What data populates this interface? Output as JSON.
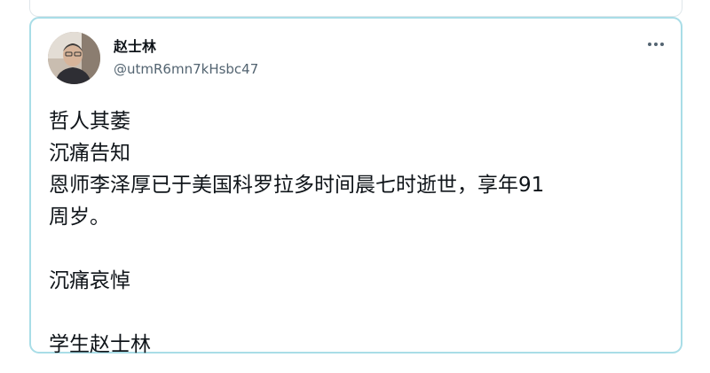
{
  "tweet": {
    "author_name": "赵士林",
    "author_handle": "@utmR6mn7kHsbc47",
    "more_icon": "more-horizontal-icon",
    "lines": [
      "哲人其萎",
      "沉痛告知",
      "恩师李泽厚已于美国科罗拉多时间晨七时逝世，享年91",
      "周岁。",
      "",
      "沉痛哀悼",
      "",
      "学生赵士林"
    ]
  },
  "colors": {
    "card_border": "#a9dde7",
    "text_primary": "#0f1419",
    "text_secondary": "#536471"
  }
}
